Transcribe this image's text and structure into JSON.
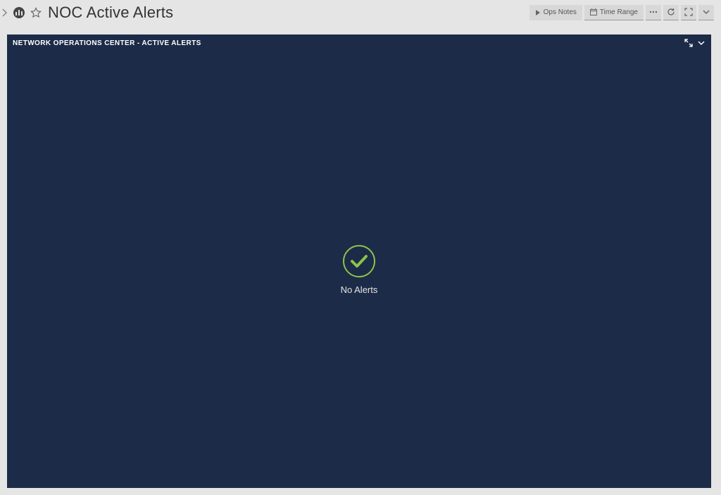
{
  "header": {
    "title": "NOC Active Alerts",
    "toolbar": {
      "ops_notes_label": "Ops Notes",
      "time_range_label": "Time Range"
    }
  },
  "widget": {
    "title": "NETWORK OPERATIONS CENTER - ACTIVE ALERTS",
    "empty_state_text": "No Alerts"
  },
  "colors": {
    "widget_bg": "#1c2b48",
    "check_green": "#8bc34a",
    "page_bg": "#e5e5e5"
  }
}
